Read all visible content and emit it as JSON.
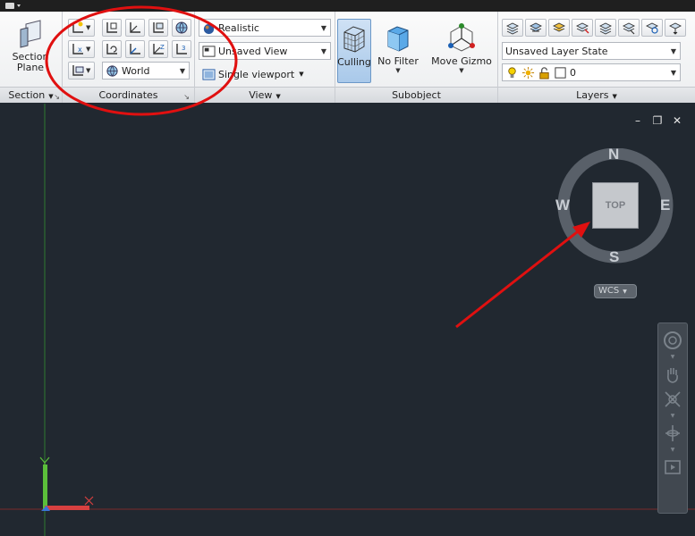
{
  "ribbon": {
    "section": {
      "title": "Section",
      "section_plane_label": "Section\nPlane"
    },
    "coordinates": {
      "title": "Coordinates",
      "ucs_combo": "World"
    },
    "view": {
      "title": "View",
      "visual_style": "Realistic",
      "named_view": "Unsaved View",
      "viewport_config": "Single viewport"
    },
    "subobject": {
      "title": "Subobject",
      "culling_label": "Culling",
      "filter_label": "No Filter",
      "gizmo_label": "Move Gizmo"
    },
    "layers": {
      "title": "Layers",
      "layer_state": "Unsaved Layer State",
      "current_layer": "0"
    }
  },
  "viewcube": {
    "north": "N",
    "south": "S",
    "east": "E",
    "west": "W",
    "face": "TOP",
    "wcs_label": "WCS"
  },
  "viewport_controls": {
    "minimize": "–",
    "restore": "❐",
    "close": "✕"
  },
  "ucs_icon": {
    "x_label": "X",
    "y_label": "Y"
  },
  "icons": {
    "section_plane": "section-plane-icon",
    "culling": "culling-cube-icon",
    "no_filter": "cube-filter-icon",
    "move_gizmo": "move-gizmo-icon",
    "steering_wheel": "steering-wheel-icon",
    "pan": "pan-hand-icon",
    "zoom": "zoom-extents-icon",
    "orbit": "orbit-icon",
    "showmotion": "showmotion-icon"
  },
  "colors": {
    "viewport_bg": "#212830",
    "annotation_red": "#e01010",
    "active_button": "#a9c9ea"
  }
}
